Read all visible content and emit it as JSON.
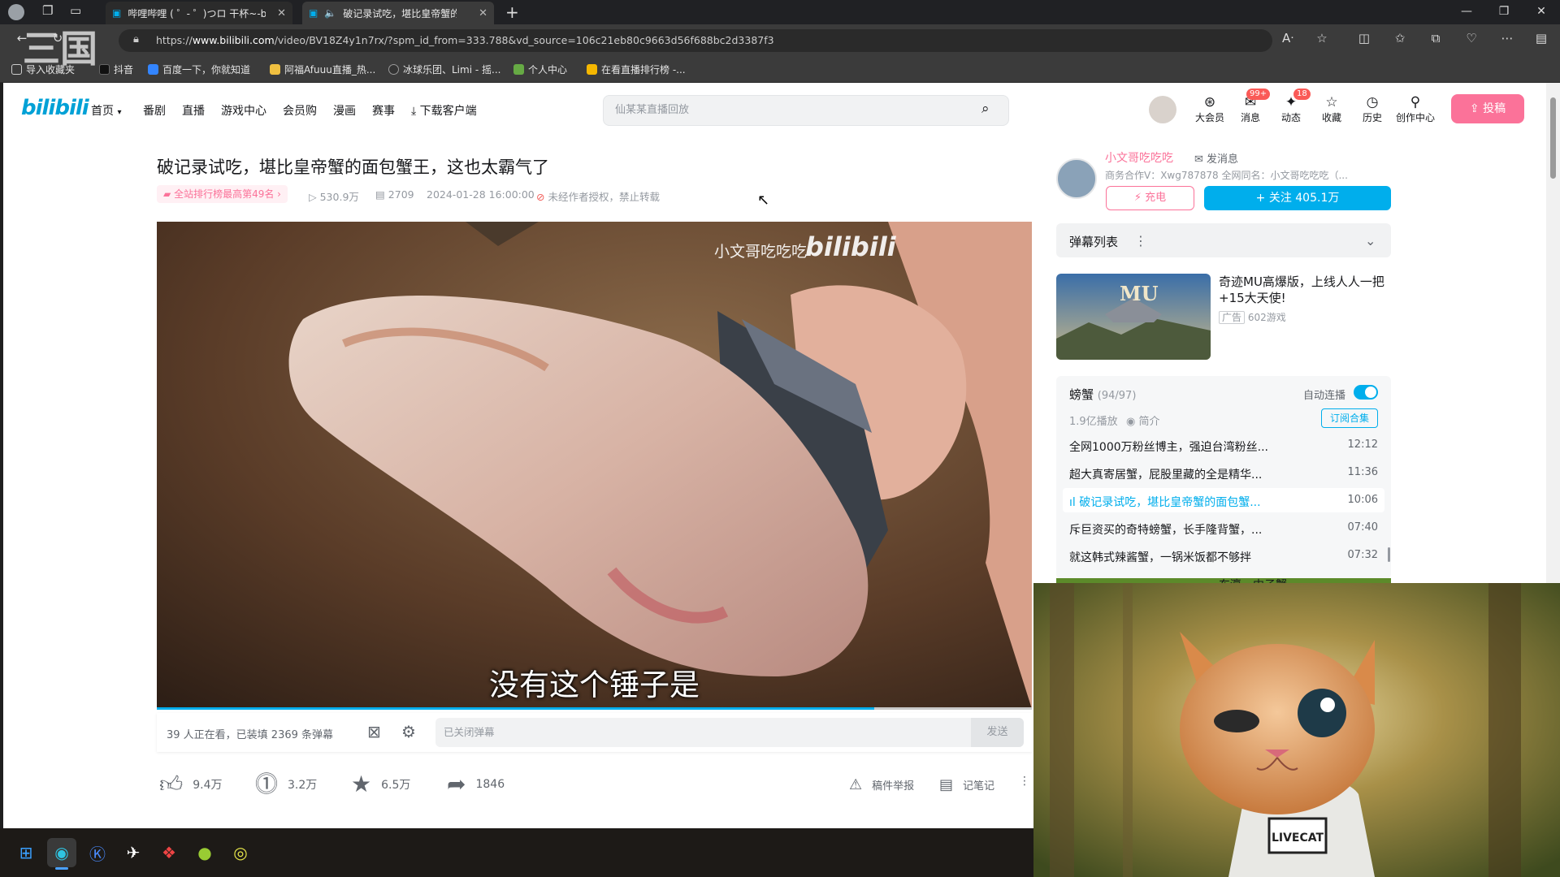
{
  "browser": {
    "tabs": [
      {
        "title": "哔哩哔哩 ( ゜- ゜)つロ 干杯~-bilib",
        "active": false
      },
      {
        "title": "破记录试吃，堪比皇帝蟹的面包",
        "active": true
      }
    ],
    "url_prefix": "https://",
    "url_domain": "www.bilibili.com",
    "url_rest": "/video/BV18Z4y1n7rx/?spm_id_from=333.788&vd_source=106c21eb80c9663d56f688bc2d3387f3",
    "bookmarks": [
      "导入收藏夹",
      "抖音",
      "百度一下，你就知道",
      "阿福Afuuu直播_热...",
      "冰球乐团、Limi - 摇...",
      "个人中心",
      "在看直播排行榜 -..."
    ],
    "watermark": "三国"
  },
  "header": {
    "logo": "bilibili",
    "nav": [
      "首页",
      "番剧",
      "直播",
      "游戏中心",
      "会员购",
      "漫画",
      "赛事",
      "下载客户端"
    ],
    "search_placeholder": "仙某某直播回放",
    "icons": [
      {
        "label": "大会员",
        "glyph": "⊛"
      },
      {
        "label": "消息",
        "glyph": "✉",
        "badge": "99+"
      },
      {
        "label": "动态",
        "glyph": "✦",
        "badge": "18"
      },
      {
        "label": "收藏",
        "glyph": "☆"
      },
      {
        "label": "历史",
        "glyph": "◷"
      },
      {
        "label": "创作中心",
        "glyph": "⚲"
      }
    ],
    "upload_label": "投稿"
  },
  "video": {
    "title": "破记录试吃，堪比皇帝蟹的面包蟹王，这也太霸气了",
    "rank": "全站排行榜最高第49名",
    "views": "530.9万",
    "danmaku": "2709",
    "date": "2024-01-28 16:00:00",
    "copyright": "未经作者授权，禁止转载",
    "subtitle": "没有这个锤子是",
    "watermark_author": "小文哥吃吃吃",
    "watermark_logo": "bilibili",
    "progress": 0.82
  },
  "danmaku_bar": {
    "status": "39 人正在看，已装填 2369 条弹幕",
    "input_placeholder": "已关闭弹幕",
    "send_label": "发送"
  },
  "actions": {
    "like": "9.4万",
    "coin": "3.2万",
    "favorite": "6.5万",
    "share": "1846",
    "report": "稿件举报",
    "notes": "记笔记"
  },
  "uploader": {
    "name": "小文哥吃吃吃",
    "message_label": "发消息",
    "desc": "商务合作V：Xwg787878 全网同名：小文哥吃吃吃（...",
    "charge_label": "充电",
    "follow_label": "关注 405.1万"
  },
  "danmaku_list_title": "弹幕列表",
  "ad": {
    "logo_text": "MU",
    "title": "奇迹MU高爆版，上线人人一把+15大天使!",
    "tag": "广告",
    "source": "602游戏"
  },
  "playlist": {
    "title": "螃蟹",
    "count": "(94/97)",
    "autoplay_label": "自动连播",
    "plays": "1.9亿播放",
    "intro_label": "简介",
    "subscribe_label": "订阅合集",
    "items": [
      {
        "title": "全网1000万粉丝博主，强迫台湾粉丝...",
        "duration": "12:12",
        "current": false
      },
      {
        "title": "超大真寄居蟹，屁股里藏的全是精华...",
        "duration": "11:36",
        "current": false
      },
      {
        "title": "破记录试吃，堪比皇帝蟹的面包蟹...",
        "duration": "10:06",
        "current": true
      },
      {
        "title": "斥巨资买的奇特螃蟹，长手隆背蟹，...",
        "duration": "07:40",
        "current": false
      },
      {
        "title": "就这韩式辣酱蟹，一锅米饭都不够拌",
        "duration": "07:32",
        "current": false
      }
    ],
    "next_partial": "东瀛 - 中子蟹..."
  },
  "overlay": {
    "shirt_text": "LIVECAT"
  }
}
